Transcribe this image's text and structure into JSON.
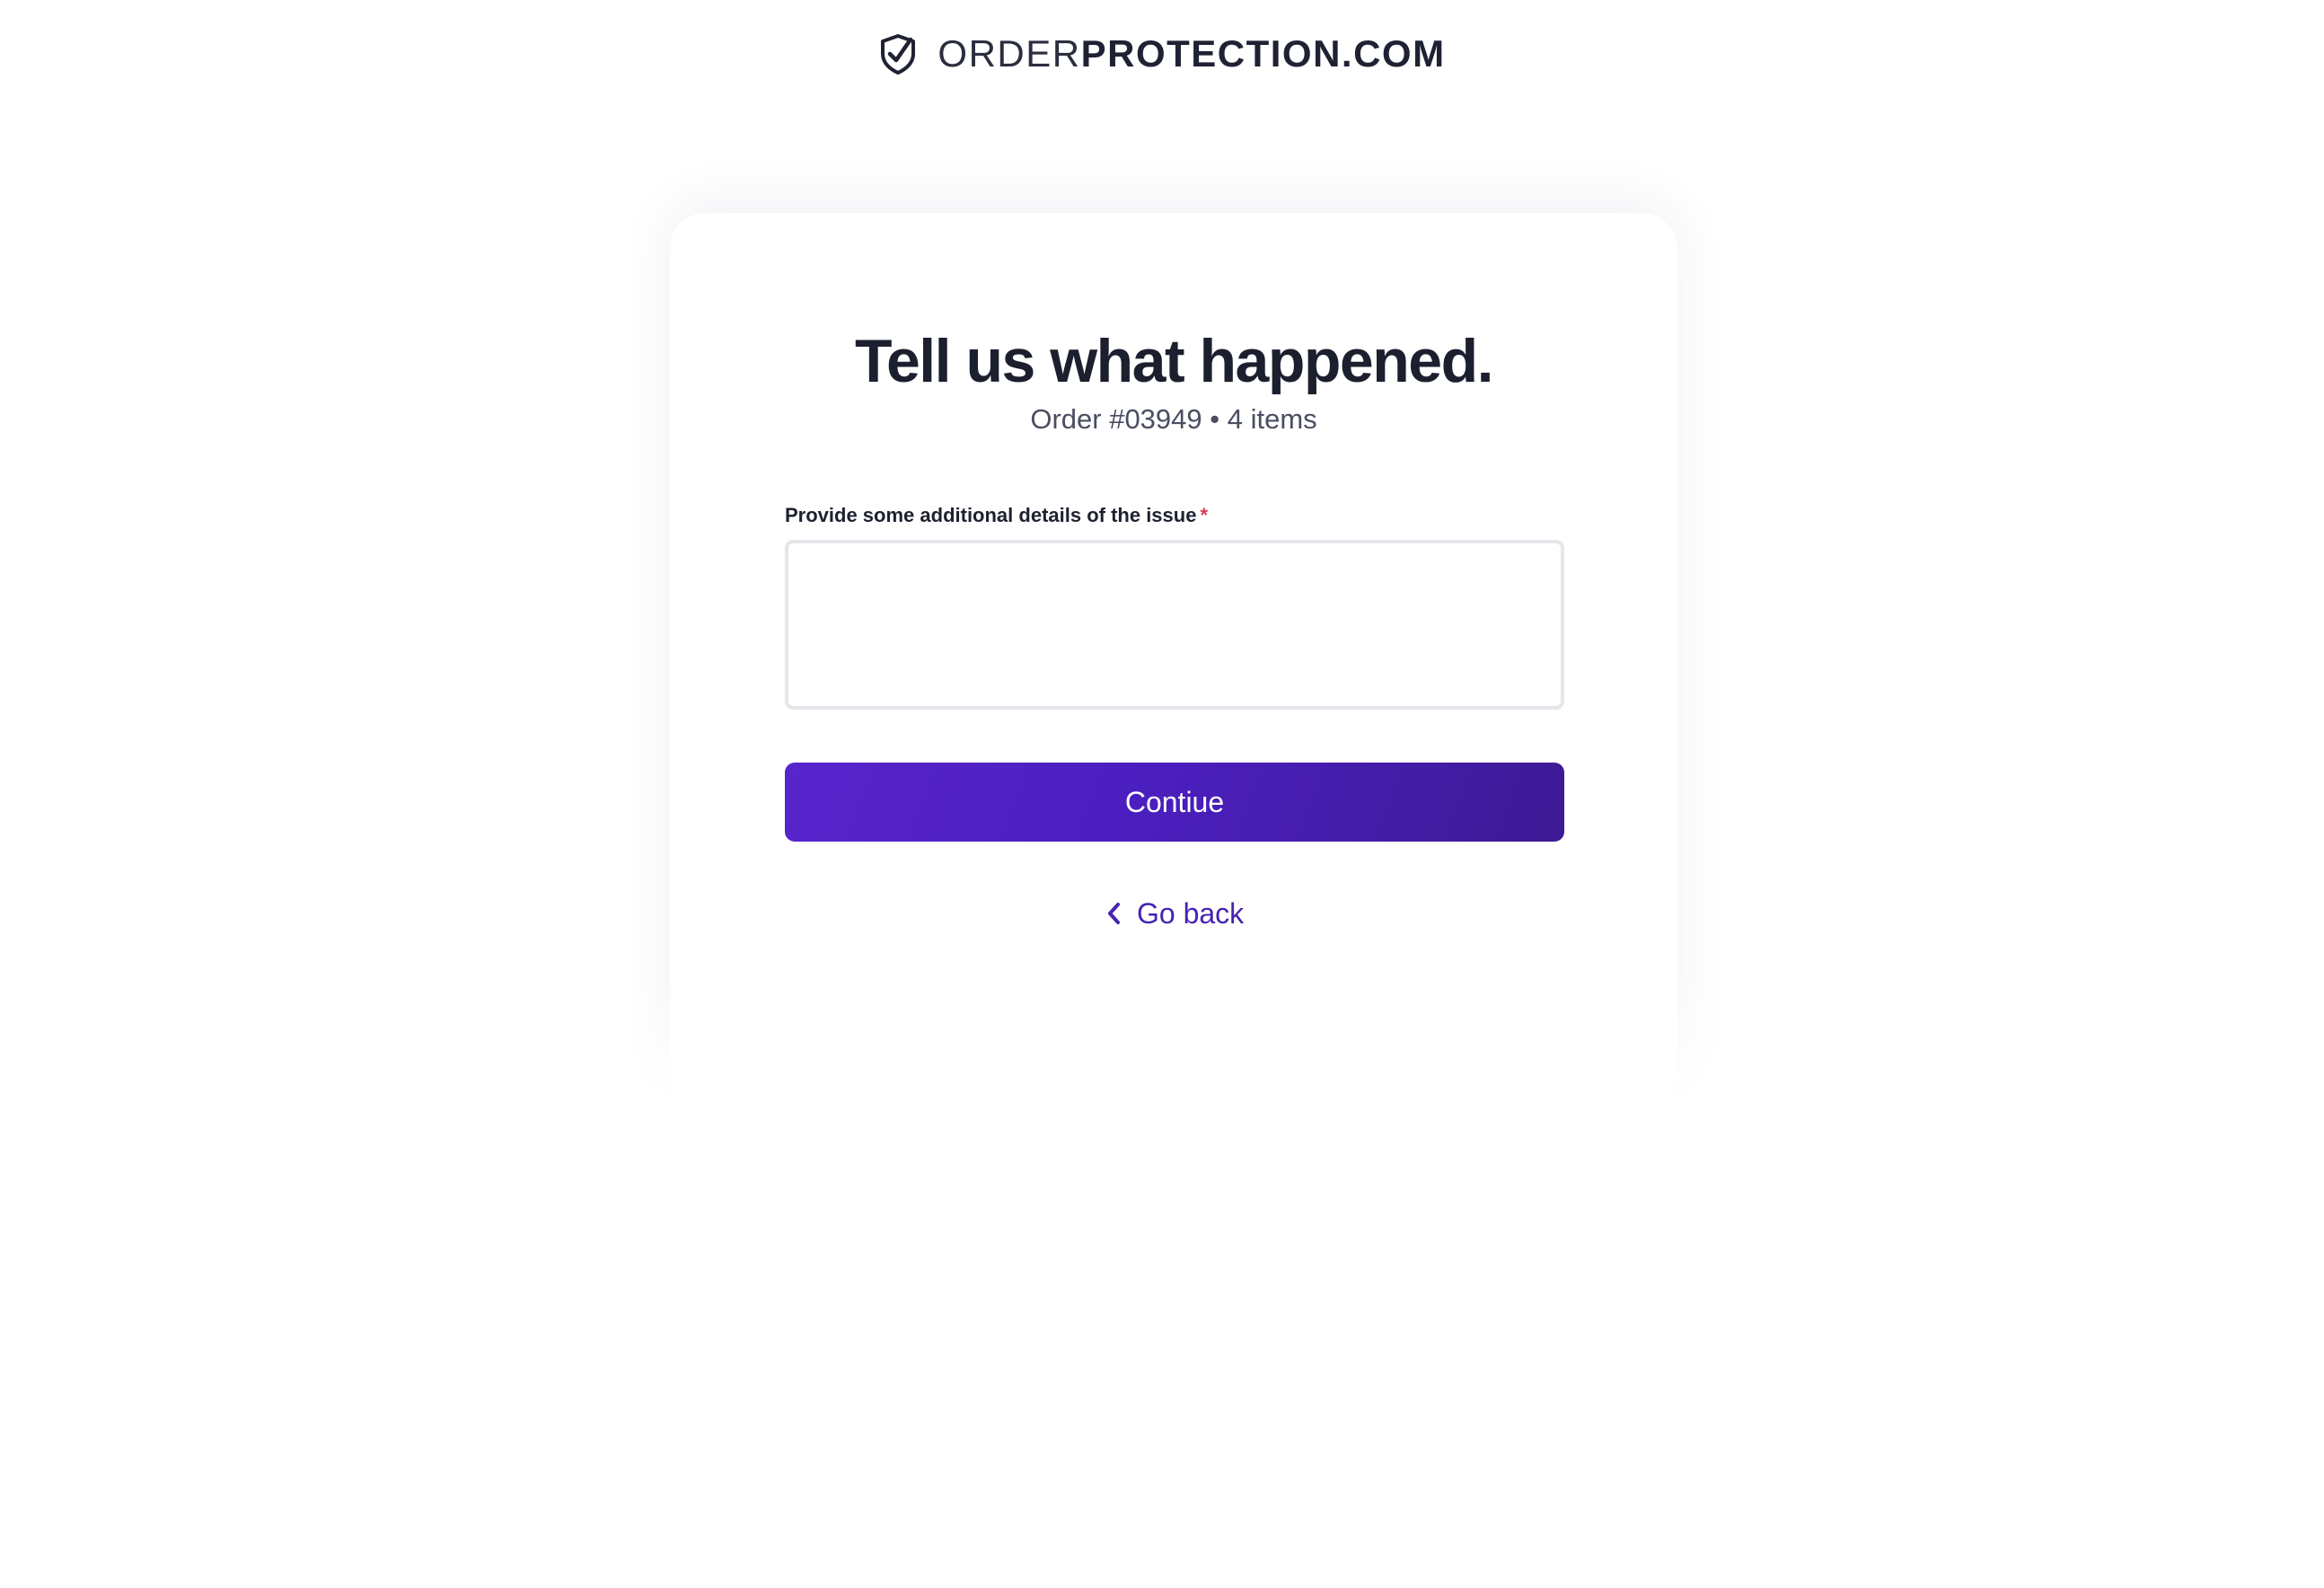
{
  "brand": {
    "name_light": "ORDER",
    "name_bold": "PROTECTION.COM",
    "icon": "shield-check-icon",
    "text_color": "#1f2233"
  },
  "form": {
    "title": "Tell us what happened.",
    "subtitle": "Order #03949 • 4 items",
    "details_label": "Provide some additional details of the issue",
    "required_marker": "*",
    "details_value": "",
    "continue_label": "Contiue",
    "go_back_label": "Go back",
    "back_icon": "chevron-left-icon"
  },
  "colors": {
    "accent": "#4b1fbf",
    "accent_dark": "#3d1a95",
    "link": "#4523b3",
    "required": "#d93a5a",
    "text": "#1c1f2e",
    "muted": "#4a4e60",
    "input_border": "#e4e6ea"
  }
}
